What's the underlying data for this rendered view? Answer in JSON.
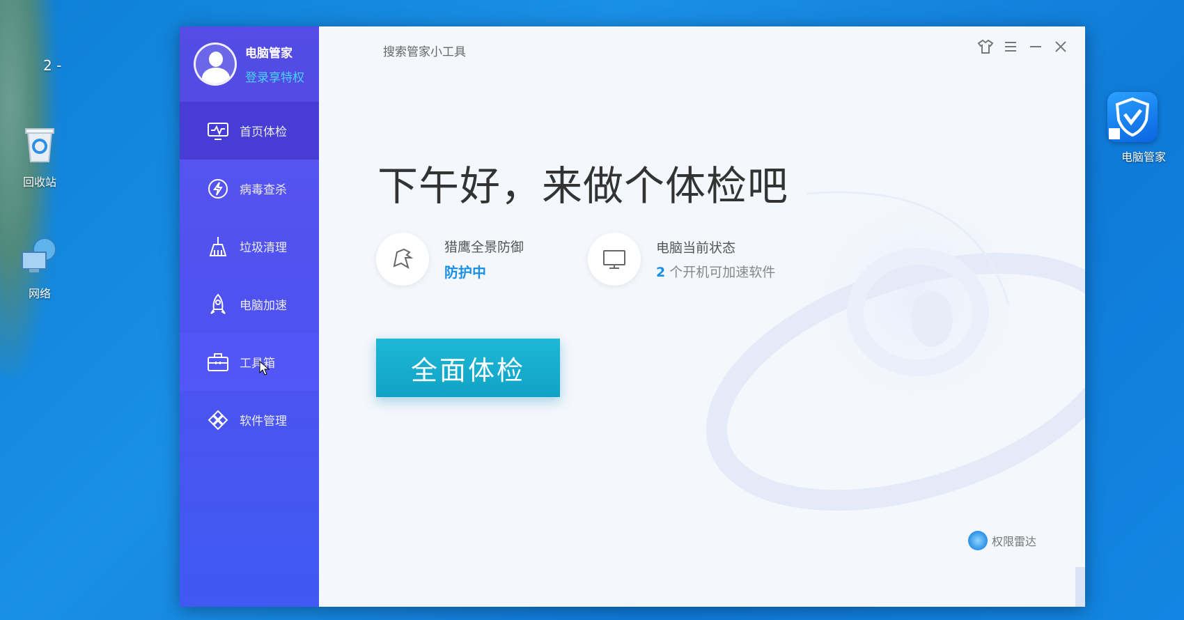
{
  "desktop": {
    "partial_label": "2 -",
    "icons": [
      {
        "name": "recycle-bin",
        "label": "回收站"
      },
      {
        "name": "network",
        "label": "网络"
      }
    ],
    "shortcut_label": "电脑管家"
  },
  "app": {
    "profile": {
      "name": "电脑管家",
      "login": "登录享特权"
    },
    "search_tool": "搜索管家小工具",
    "nav": [
      {
        "label": "首页体检",
        "icon": "monitor-pulse-icon"
      },
      {
        "label": "病毒查杀",
        "icon": "lightning-icon"
      },
      {
        "label": "垃圾清理",
        "icon": "broom-icon"
      },
      {
        "label": "电脑加速",
        "icon": "rocket-icon"
      },
      {
        "label": "工具箱",
        "icon": "toolbox-icon"
      },
      {
        "label": "软件管理",
        "icon": "software-icon"
      }
    ],
    "greeting": "下午好，来做个体检吧",
    "protection": {
      "title": "猎鹰全景防御",
      "value": "防护中"
    },
    "pc_status": {
      "title": "电脑当前状态",
      "count": "2",
      "detail": "个开机可加速软件"
    },
    "scan_button": "全面体检",
    "radar": "权限雷达",
    "accent": "#1a8fe6",
    "button_color": "#15aecf",
    "sidebar_color": "#5052ef"
  }
}
